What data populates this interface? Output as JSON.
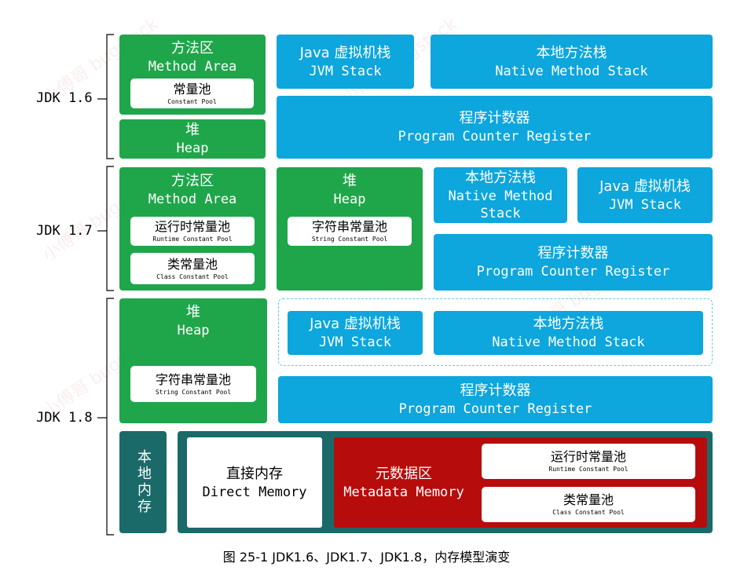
{
  "versions": [
    "JDK 1.6",
    "JDK 1.7",
    "JDK 1.8"
  ],
  "jdk16": {
    "method_area": {
      "cn": "方法区",
      "en": "Method Area"
    },
    "constant_pool": {
      "cn": "常量池",
      "en": "Constant Pool"
    },
    "heap": {
      "cn": "堆",
      "en": "Heap"
    },
    "jvm_stack": {
      "cn": "Java 虚拟机栈",
      "en": "JVM Stack"
    },
    "native_stack": {
      "cn": "本地方法栈",
      "en": "Native Method Stack"
    },
    "pc_register": {
      "cn": "程序计数器",
      "en": "Program Counter Register"
    }
  },
  "jdk17": {
    "method_area": {
      "cn": "方法区",
      "en": "Method Area"
    },
    "runtime_pool": {
      "cn": "运行时常量池",
      "en": "Runtime Constant Pool"
    },
    "class_pool": {
      "cn": "类常量池",
      "en": "Class Constant Pool"
    },
    "heap": {
      "cn": "堆",
      "en": "Heap"
    },
    "string_pool": {
      "cn": "字符串常量池",
      "en": "String Constant Pool"
    },
    "native_stack": {
      "cn": "本地方法栈",
      "en1": "Native Method",
      "en2": "Stack"
    },
    "jvm_stack": {
      "cn": "Java 虚拟机栈",
      "en": "JVM Stack"
    },
    "pc_register": {
      "cn": "程序计数器",
      "en": "Program Counter Register"
    }
  },
  "jdk18": {
    "heap": {
      "cn": "堆",
      "en": "Heap"
    },
    "string_pool": {
      "cn": "字符串常量池",
      "en": "String Constant Pool"
    },
    "jvm_stack": {
      "cn": "Java 虚拟机栈",
      "en": "JVM Stack"
    },
    "native_stack": {
      "cn": "本地方法栈",
      "en": "Native Method Stack"
    },
    "pc_register": {
      "cn": "程序计数器",
      "en": "Program Counter Register"
    },
    "local_memory": "本地内存",
    "direct_memory": {
      "cn": "直接内存",
      "en": "Direct Memory"
    },
    "metadata": {
      "cn": "元数据区",
      "en": "Metadata Memory"
    },
    "runtime_pool": {
      "cn": "运行时常量池",
      "en": "Runtime Constant Pool"
    },
    "class_pool": {
      "cn": "类常量池",
      "en": "Class Constant Pool"
    }
  },
  "caption": "图 25-1 JDK1.6、JDK1.7、JDK1.8，内存模型演变",
  "watermark": "小傅哥 bugstack",
  "colors": {
    "green": "#1fa64a",
    "blue": "#0da6dd",
    "teal": "#1b6a6a",
    "red": "#b70c0c"
  }
}
